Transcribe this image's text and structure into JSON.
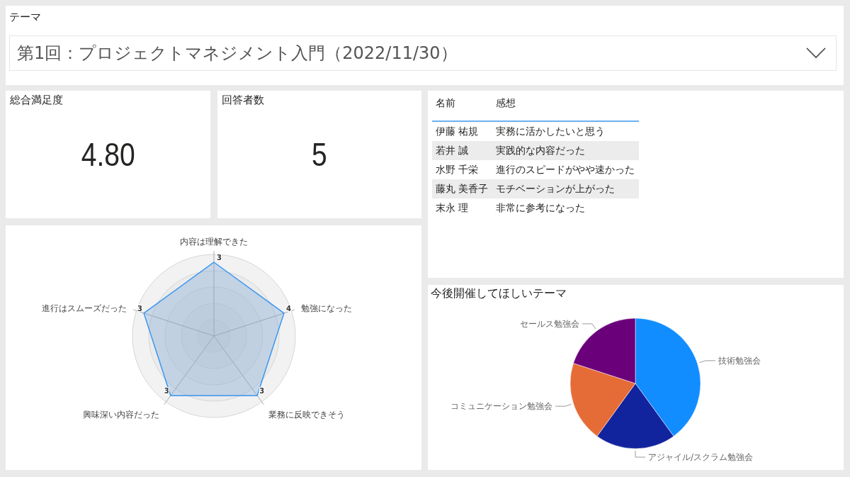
{
  "theme_filter": {
    "label": "テーマ",
    "value": "第1回：プロジェクトマネジメント入門（2022/11/30）"
  },
  "kpis": [
    {
      "title": "総合満足度",
      "value": "4.80"
    },
    {
      "title": "回答者数",
      "value": "5"
    }
  ],
  "comments_table": {
    "columns": [
      "名前",
      "感想"
    ],
    "rows": [
      [
        "伊藤 祐規",
        "実務に活かしたいと思う"
      ],
      [
        "若井 誠",
        "実践的な内容だった"
      ],
      [
        "水野 千栄",
        "進行のスピードがやや速かった"
      ],
      [
        "藤丸 美香子",
        "モチベーションが上がった"
      ],
      [
        "末永 理",
        "非常に参考になった"
      ]
    ]
  },
  "radar": {
    "axes": [
      {
        "label": "内容は理解できた",
        "value": "3"
      },
      {
        "label": "進行はスムーズだった",
        "value": "3"
      },
      {
        "label": "勉強になった",
        "value": "4"
      },
      {
        "label": "興味深い内容だった",
        "value": "3"
      },
      {
        "label": "業務に反映できそう",
        "value": "3"
      }
    ]
  },
  "theme_requests": {
    "title": "今後開催してほしいテーマ",
    "chart_data": {
      "type": "pie",
      "categories": [
        "技術勉強会",
        "アジャイル/スクラム勉強会",
        "コミュニケーション勉強会",
        "セールス勉強会"
      ],
      "values": [
        40,
        20,
        20,
        20
      ],
      "colors": [
        "#118dff",
        "#12239e",
        "#e66c37",
        "#6b007b"
      ]
    }
  }
}
